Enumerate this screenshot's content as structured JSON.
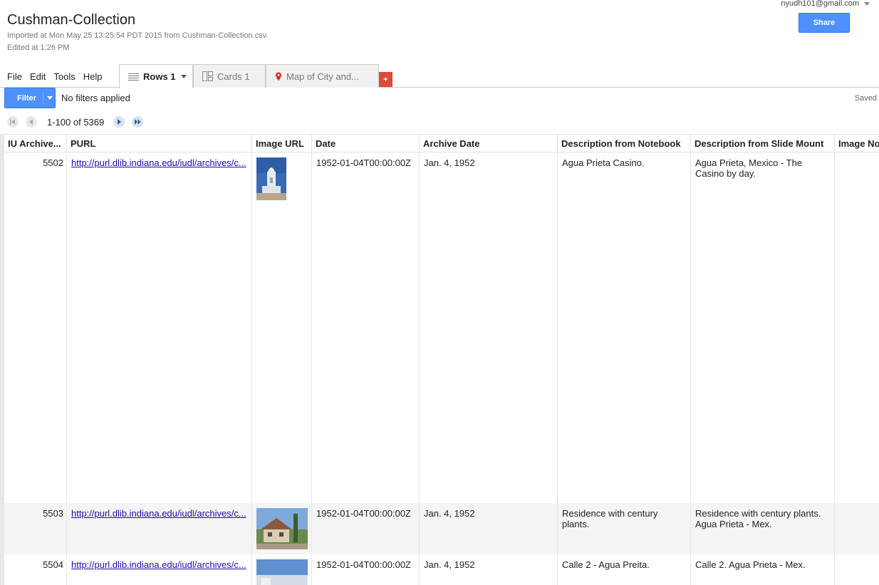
{
  "doc": {
    "title": "Cushman-Collection",
    "imported": "Imported at Mon May 25 13:25:54 PDT 2015 from Cushman-Collection.csv.",
    "edited": "Edited at 1:26 PM",
    "account": "nyudh101@gmail.com",
    "share_label": "Share"
  },
  "menu": [
    "File",
    "Edit",
    "Tools",
    "Help"
  ],
  "tabs": [
    {
      "label": "Rows 1",
      "icon": "rows-icon",
      "active": true
    },
    {
      "label": "Cards 1",
      "icon": "cards-icon",
      "active": false
    },
    {
      "label": "Map of City and...",
      "icon": "map-pin-icon",
      "active": false
    }
  ],
  "add_tab_label": "+",
  "filter": {
    "label": "Filter",
    "status": "No filters applied"
  },
  "save_status": "Saved",
  "pager": {
    "range": "1-100 of 5369"
  },
  "columns": [
    "IU Archive...",
    "PURL",
    "Image URL",
    "Date",
    "Archive Date",
    "Description from Notebook",
    "Description from Slide Mount",
    "Image No"
  ],
  "rows": [
    {
      "id": "5502",
      "purl": "http://purl.dlib.indiana.edu/iudl/archives/c...",
      "image": "white domed casino tower on blue sky",
      "date": "1952-01-04T00:00:00Z",
      "archive_date": "Jan. 4, 1952",
      "notebook": "Agua Prieta Casino.",
      "slide": "Agua Prieta, Mexico - The Casino by day."
    },
    {
      "id": "5503",
      "purl": "http://purl.dlib.indiana.edu/iudl/archives/c...",
      "image": "house with century plants",
      "date": "1952-01-04T00:00:00Z",
      "archive_date": "Jan. 4, 1952",
      "notebook": "Residence with century plants.",
      "slide": "Residence with century plants. Agua Prieta - Mex."
    },
    {
      "id": "5504",
      "purl": "http://purl.dlib.indiana.edu/iudl/archives/c...",
      "image": "street under blue sky",
      "date": "1952-01-04T00:00:00Z",
      "archive_date": "Jan. 4, 1952",
      "notebook": "Calle 2 - Agua Preita.",
      "slide": "Calle 2. Agua Prieta - Mex."
    }
  ],
  "colors": {
    "accent": "#4d90fe",
    "add_tab": "#dd4b39",
    "link": "#1a0dab"
  }
}
